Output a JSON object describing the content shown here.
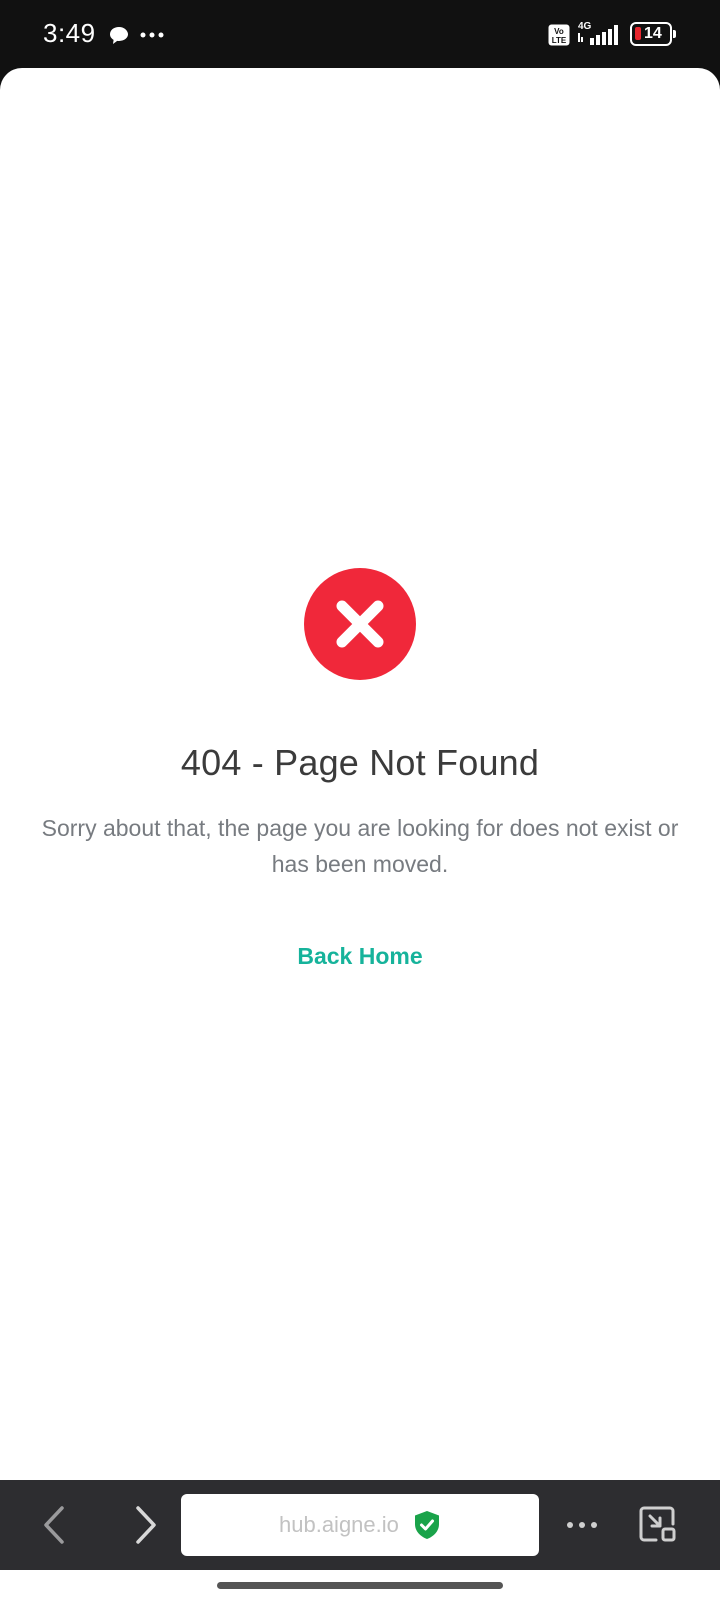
{
  "status_bar": {
    "time": "3:49",
    "network": "4G",
    "volte": "Vo LTE",
    "battery": "14",
    "battery_color": "#e8262e"
  },
  "error": {
    "icon": "error-x-icon",
    "icon_color": "#f0283a",
    "title": "404 - Page Not Found",
    "message": "Sorry about that, the page you are looking for does not exist or has been moved.",
    "action_label": "Back Home",
    "action_color": "#16b39b"
  },
  "browser": {
    "url": "hub.aigne.io",
    "secure_icon": "shield-check-icon",
    "secure_color": "#1aa34a"
  }
}
